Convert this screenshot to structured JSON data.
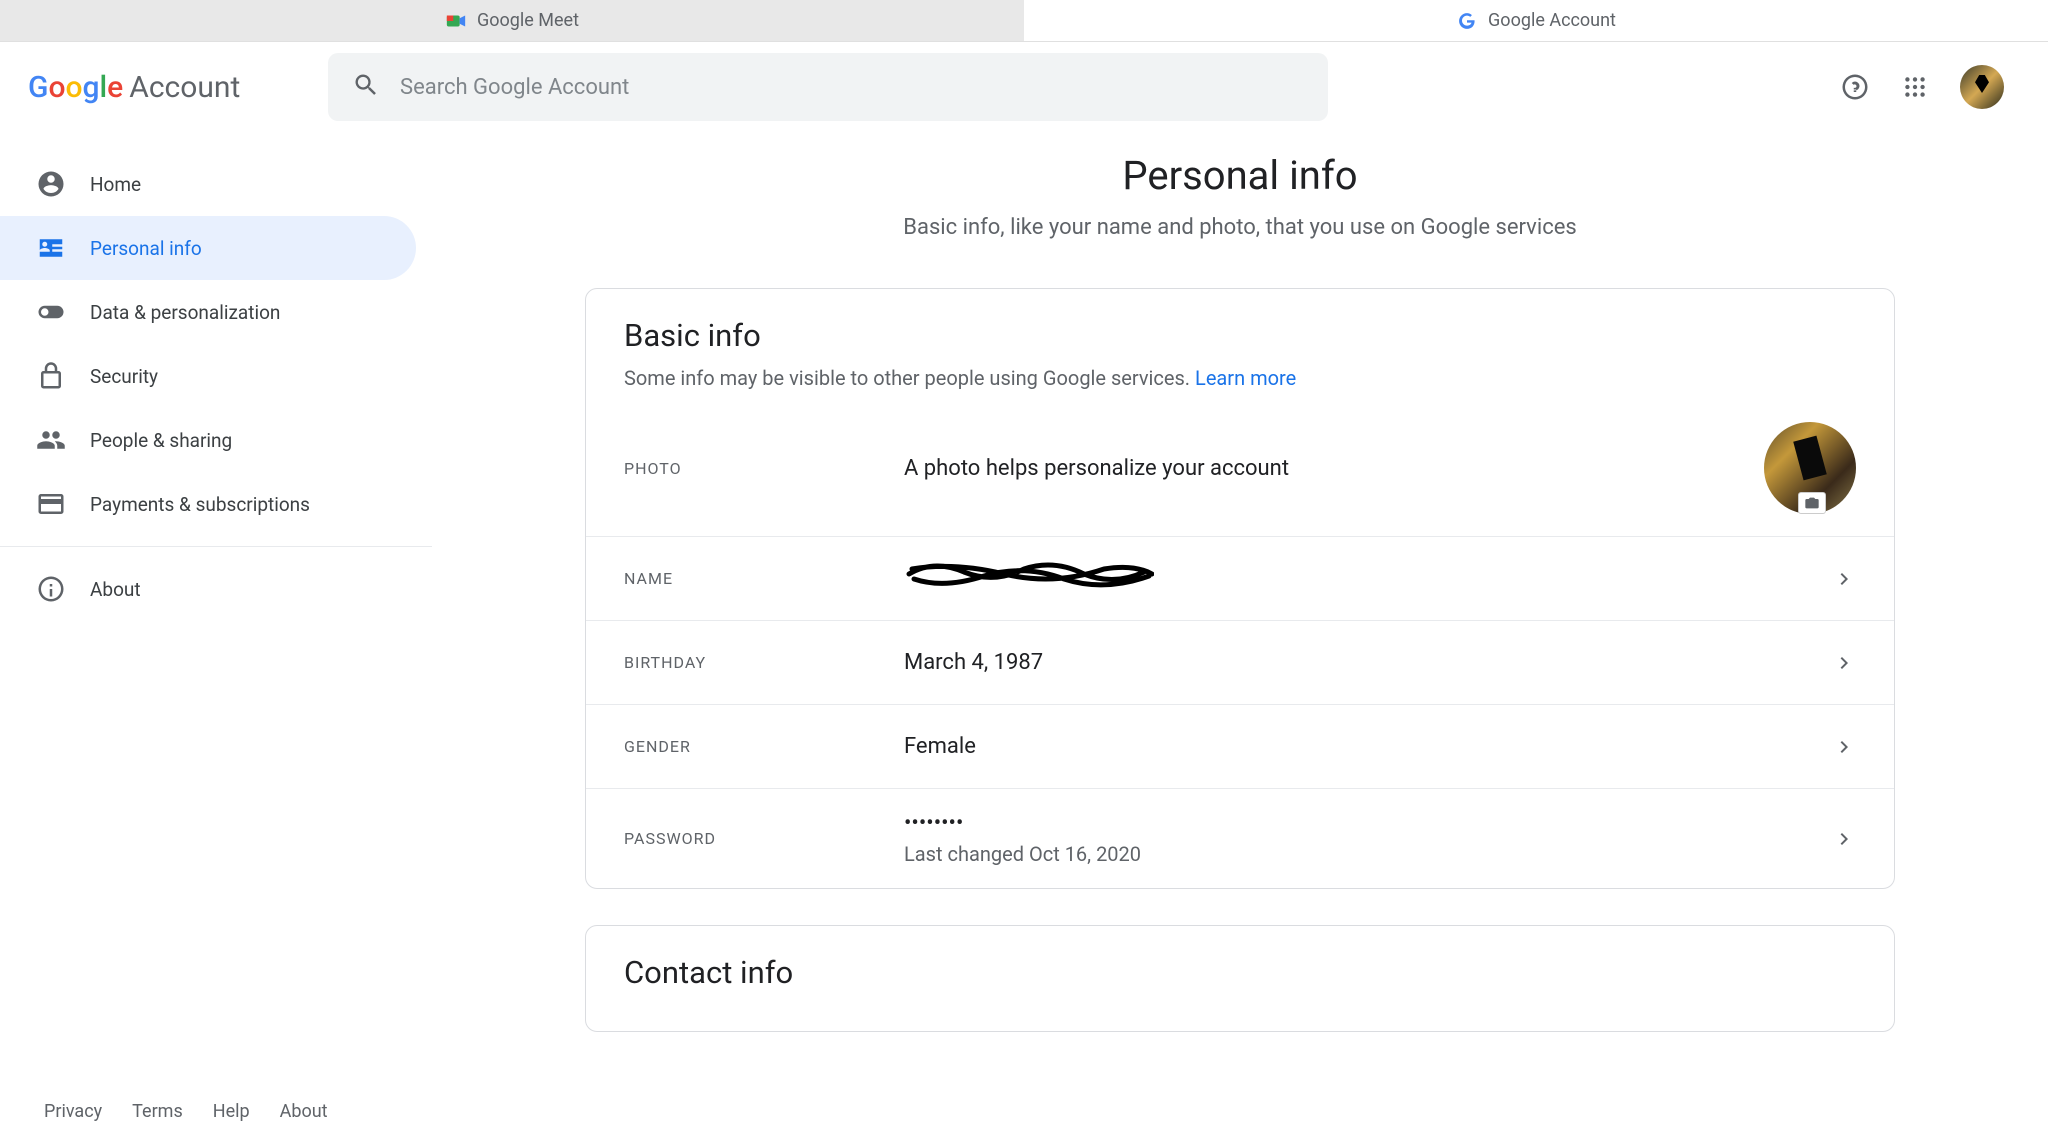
{
  "browser": {
    "tabs": [
      {
        "label": "Google Meet",
        "active": false
      },
      {
        "label": "Google Account",
        "active": true
      }
    ]
  },
  "header": {
    "logo_account": "Account",
    "search_placeholder": "Search Google Account"
  },
  "sidebar": {
    "items": [
      {
        "label": "Home"
      },
      {
        "label": "Personal info"
      },
      {
        "label": "Data & personalization"
      },
      {
        "label": "Security"
      },
      {
        "label": "People & sharing"
      },
      {
        "label": "Payments & subscriptions"
      },
      {
        "label": "About"
      }
    ]
  },
  "page": {
    "title": "Personal info",
    "subtitle": "Basic info, like your name and photo, that you use on Google services"
  },
  "basic_info": {
    "title": "Basic info",
    "subtitle": "Some info may be visible to other people using Google services. ",
    "learn_more": "Learn more",
    "rows": {
      "photo": {
        "label": "PHOTO",
        "value": "A photo helps personalize your account"
      },
      "name": {
        "label": "NAME"
      },
      "birthday": {
        "label": "BIRTHDAY",
        "value": "March 4, 1987"
      },
      "gender": {
        "label": "GENDER",
        "value": "Female"
      },
      "password": {
        "label": "PASSWORD",
        "value": "••••••••",
        "sub": "Last changed Oct 16, 2020"
      }
    }
  },
  "contact_info": {
    "title": "Contact info"
  },
  "footer": {
    "privacy": "Privacy",
    "terms": "Terms",
    "help": "Help",
    "about": "About"
  }
}
